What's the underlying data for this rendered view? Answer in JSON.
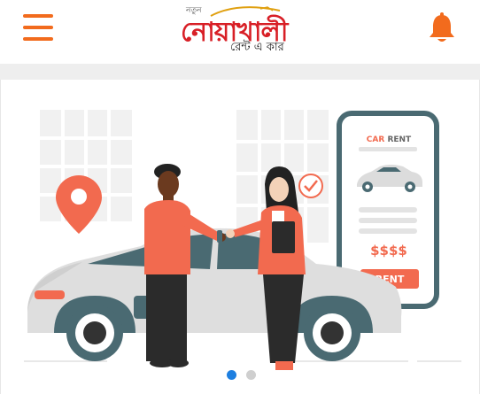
{
  "header": {
    "menu_icon": "hamburger-menu-icon",
    "notification_icon": "bell-icon",
    "logo": {
      "small_text": "নতুন",
      "main_text": "নোয়াখালী",
      "sub_text": "রেন্ট এ কার"
    }
  },
  "banner": {
    "phone_card": {
      "title_part1": "CAR",
      "title_part2": " RENT",
      "price": "$$$$",
      "button_label": "RENT"
    },
    "icons": [
      "location-pin-icon",
      "check-badge-icon"
    ]
  },
  "carousel": {
    "total_slides": 2,
    "active_index": 0
  },
  "colors": {
    "brand_orange": "#f26b1d",
    "logo_red": "#d81f26",
    "accent_salmon": "#f26a4f",
    "phone_border": "#4a6a72",
    "dot_active": "#1e7fe0",
    "dot_inactive": "#cfcfcf"
  }
}
